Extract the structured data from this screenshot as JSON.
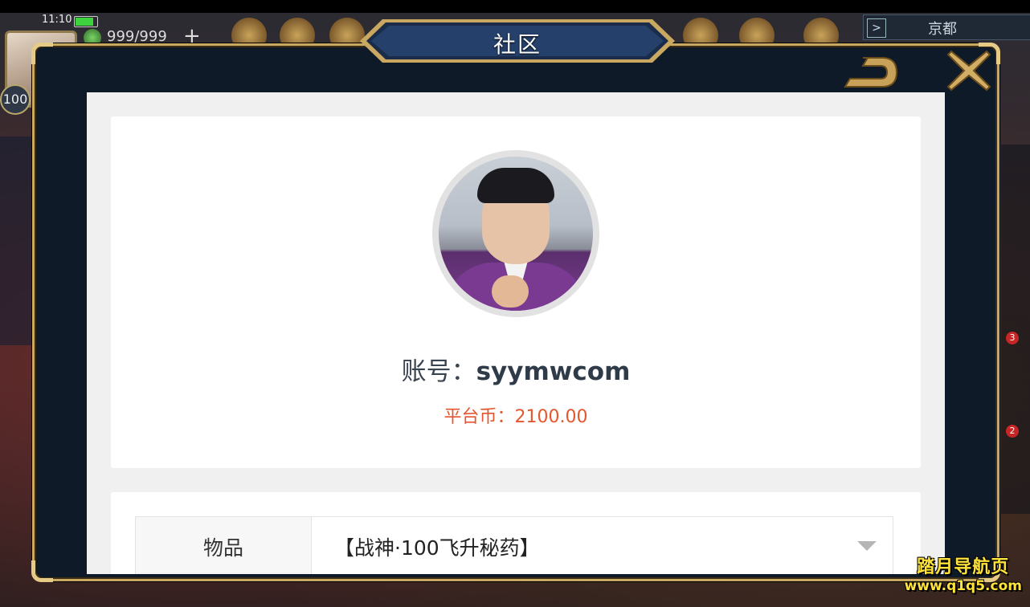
{
  "status_bar": {
    "time": "11:10"
  },
  "game_hud": {
    "stamina": "999/999",
    "plus": "+",
    "level": "100",
    "city": "京都",
    "city_arrow": ">",
    "badges": [
      "3",
      "2"
    ]
  },
  "dialog": {
    "title": "社区",
    "back_icon": "back-arrow-icon",
    "close_icon": "close-x-icon"
  },
  "profile": {
    "account_label": "账号：",
    "account_value": "syymwcom",
    "coins_label": "平台币：",
    "coins_value": "2100.00"
  },
  "item_form": {
    "label": "物品",
    "selected_value": "【战神·100飞升秘药】"
  },
  "watermark": {
    "line1": "踏月导航页",
    "line2": "www.q1q5.com"
  },
  "colors": {
    "frame_gold": "#c9a961",
    "frame_dark": "#0f1a29",
    "accent_orange": "#e4572e",
    "text_dark": "#2f3b49"
  }
}
